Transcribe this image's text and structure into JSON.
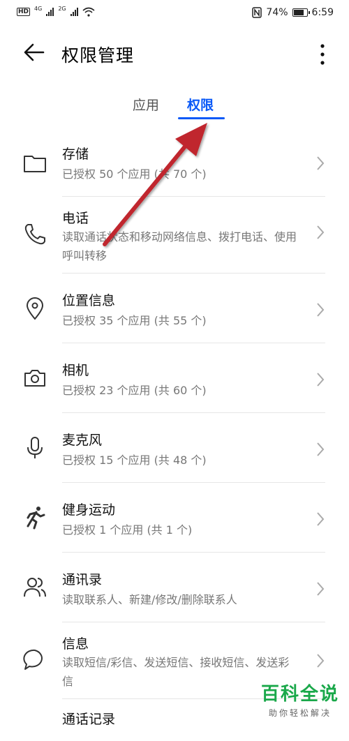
{
  "status_bar": {
    "hd_label": "HD",
    "net1": "4G",
    "net2": "2G",
    "battery_percent": "74%",
    "time": "6:59"
  },
  "header": {
    "title": "权限管理"
  },
  "tabs": [
    {
      "label": "应用",
      "active": false
    },
    {
      "label": "权限",
      "active": true
    }
  ],
  "permissions": [
    {
      "title": "存储",
      "subtitle": "已授权 50 个应用 (共 70 个)",
      "icon": "folder-icon"
    },
    {
      "title": "电话",
      "subtitle": "读取通话状态和移动网络信息、拨打电话、使用呼叫转移",
      "icon": "phone-icon"
    },
    {
      "title": "位置信息",
      "subtitle": "已授权 35 个应用 (共 55 个)",
      "icon": "location-pin-icon"
    },
    {
      "title": "相机",
      "subtitle": "已授权 23 个应用 (共 60 个)",
      "icon": "camera-icon"
    },
    {
      "title": "麦克风",
      "subtitle": "已授权 15 个应用 (共 48 个)",
      "icon": "microphone-icon"
    },
    {
      "title": "健身运动",
      "subtitle": "已授权 1 个应用 (共 1 个)",
      "icon": "running-person-icon"
    },
    {
      "title": "通讯录",
      "subtitle": "读取联系人、新建/修改/删除联系人",
      "icon": "contacts-icon"
    },
    {
      "title": "信息",
      "subtitle": "读取短信/彩信、发送短信、接收短信、发送彩信",
      "icon": "message-bubble-icon"
    },
    {
      "title": "通话记录",
      "subtitle": "",
      "icon": "call-log-icon"
    }
  ],
  "colors": {
    "accent": "#0a59f7",
    "annotation_arrow": "#c0262d",
    "watermark": "#1aa84a"
  },
  "watermark": {
    "main": "百科全说",
    "sub": "助你轻松解决"
  }
}
